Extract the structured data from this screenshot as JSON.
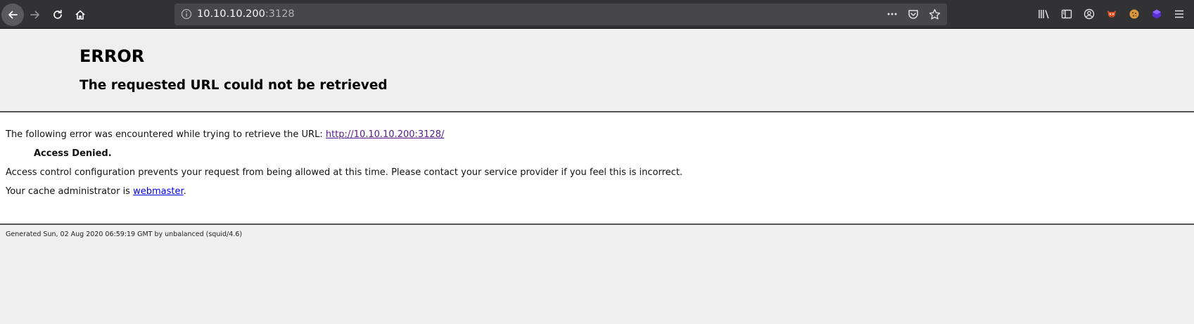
{
  "browser": {
    "url_host": "10.10.10.200",
    "url_port": ":3128",
    "colors": {
      "toolbar": "#323234",
      "urlbar": "#474749"
    },
    "icons": [
      "back-arrow-icon",
      "forward-arrow-icon",
      "reload-icon",
      "home-icon",
      "info-icon",
      "more-dots-icon",
      "pocket-icon",
      "bookmark-star-icon",
      "library-icon",
      "sidebar-icon",
      "account-icon",
      "extension-fox-icon",
      "cookie-icon",
      "extension-cube-icon",
      "hamburger-menu-icon"
    ]
  },
  "page": {
    "title": "ERROR",
    "subtitle": "The requested URL could not be retrieved",
    "intro_text": "The following error was encountered while trying to retrieve the URL: ",
    "url_link": "http://10.10.10.200:3128/",
    "error_label": "Access Denied.",
    "description": "Access control configuration prevents your request from being allowed at this time. Please contact your service provider if you feel this is incorrect.",
    "admin_text": "Your cache administrator is ",
    "admin_link": "webmaster",
    "admin_suffix": ".",
    "footer": "Generated Sun, 02 Aug 2020 06:59:19 GMT by unbalanced (squid/4.6)"
  }
}
